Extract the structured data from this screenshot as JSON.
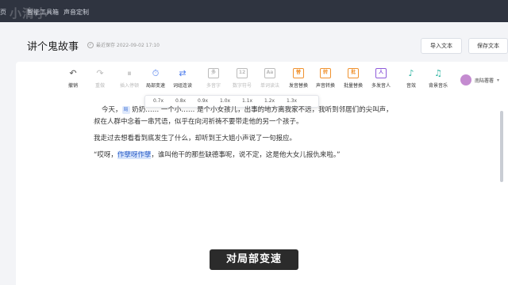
{
  "topnav": {
    "watermark": "小清小",
    "items": [
      "首页",
      "智能工具箱",
      "声音定制"
    ]
  },
  "header": {
    "doc_title": "讲个鬼故事",
    "save_status": "最近保存 2022-09-02 17:10",
    "import_label": "导入文本",
    "save_label": "保存文本"
  },
  "toolbar": {
    "tools": [
      {
        "label": "撤销",
        "icon": "undo-icon",
        "glyph": "↶"
      },
      {
        "label": "重做",
        "icon": "redo-icon",
        "glyph": "↷"
      },
      {
        "label": "插入停顿",
        "icon": "pause-icon",
        "glyph": "⏸"
      },
      {
        "label": "局部变速",
        "icon": "speed-icon",
        "glyph": "⏱"
      },
      {
        "label": "词组连读",
        "icon": "link-icon",
        "glyph": "⇄"
      },
      {
        "label": "多音字",
        "icon": "polyphone-icon",
        "glyph": "多"
      },
      {
        "label": "数字符号",
        "icon": "number-icon",
        "glyph": "12"
      },
      {
        "label": "单词读法",
        "icon": "word-icon",
        "glyph": "Aa"
      },
      {
        "label": "发音替换",
        "icon": "replace-icon",
        "glyph": "替"
      },
      {
        "label": "声音转换",
        "icon": "voice-convert-icon",
        "glyph": "转"
      },
      {
        "label": "批量替换",
        "icon": "batch-replace-icon",
        "glyph": "批"
      },
      {
        "label": "多发音人",
        "icon": "multi-speaker-icon",
        "glyph": "人"
      },
      {
        "label": "音效",
        "icon": "sound-effect-icon",
        "glyph": "♪"
      },
      {
        "label": "背景音乐",
        "icon": "bgm-icon",
        "glyph": "♫"
      }
    ],
    "user_name": "南陆署署",
    "caret": "▾"
  },
  "speed_options": [
    "0.7x",
    "0.8x",
    "0.9x",
    "1.0x",
    "1.1x",
    "1.2x",
    "1.3x"
  ],
  "content": {
    "p1_a": "今天，",
    "p1_tag": "局",
    "p1_b": " 奶奶…… 一个小…… 是个小女孩儿，出事的地方离我家不远，我听到邻居们的尖叫声，",
    "p2": "叔在人群中念着一串咒语，似乎在向河祈祷不要带走他的另一个孩子。",
    "p3": "我走过去想看看到底发生了什么，却听到王大姐小声说了一句报应。",
    "p4_a": "“哎呀，",
    "p4_hl": "作孽呀作孽",
    "p4_b": "，谁叫他干的那些缺德事呢，说不定，这是他大女儿报仇来啦。”"
  },
  "subtitle": "对局部变速"
}
